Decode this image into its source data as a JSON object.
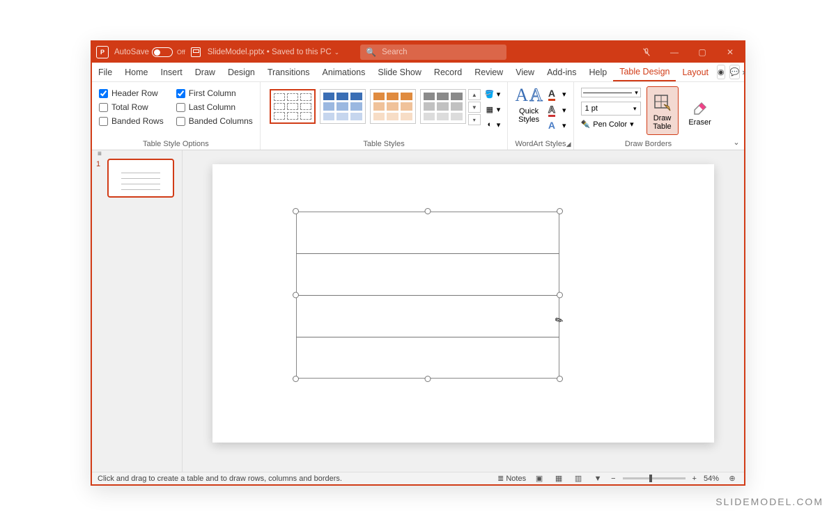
{
  "titlebar": {
    "autosave_label": "AutoSave",
    "autosave_state": "Off",
    "document_name": "SlideModel.pptx",
    "save_status": "Saved to this PC",
    "search_placeholder": "Search"
  },
  "tabs": {
    "file": "File",
    "home": "Home",
    "insert": "Insert",
    "draw": "Draw",
    "design": "Design",
    "transitions": "Transitions",
    "animations": "Animations",
    "slide_show": "Slide Show",
    "record": "Record",
    "review": "Review",
    "view": "View",
    "addins": "Add-ins",
    "help": "Help",
    "table_design": "Table Design",
    "layout": "Layout"
  },
  "ribbon": {
    "style_options": {
      "header_row": "Header Row",
      "total_row": "Total Row",
      "banded_rows": "Banded Rows",
      "first_column": "First Column",
      "last_column": "Last Column",
      "banded_columns": "Banded Columns",
      "group_label": "Table Style Options",
      "checked": {
        "header_row": true,
        "total_row": false,
        "banded_rows": false,
        "first_column": true,
        "last_column": false,
        "banded_columns": false
      }
    },
    "table_styles": {
      "group_label": "Table Styles"
    },
    "wordart": {
      "quick_styles": "Quick\nStyles",
      "group_label": "WordArt Styles"
    },
    "draw_borders": {
      "pen_weight": "1 pt",
      "pen_color": "Pen Color",
      "draw_table": "Draw\nTable",
      "eraser": "Eraser",
      "group_label": "Draw Borders"
    }
  },
  "thumbnails": {
    "slide1_number": "1"
  },
  "statusbar": {
    "hint": "Click and drag to create a table and to draw rows, columns and borders.",
    "notes": "Notes",
    "zoom_percent": "54%"
  },
  "attribution": "SLIDEMODEL.COM"
}
